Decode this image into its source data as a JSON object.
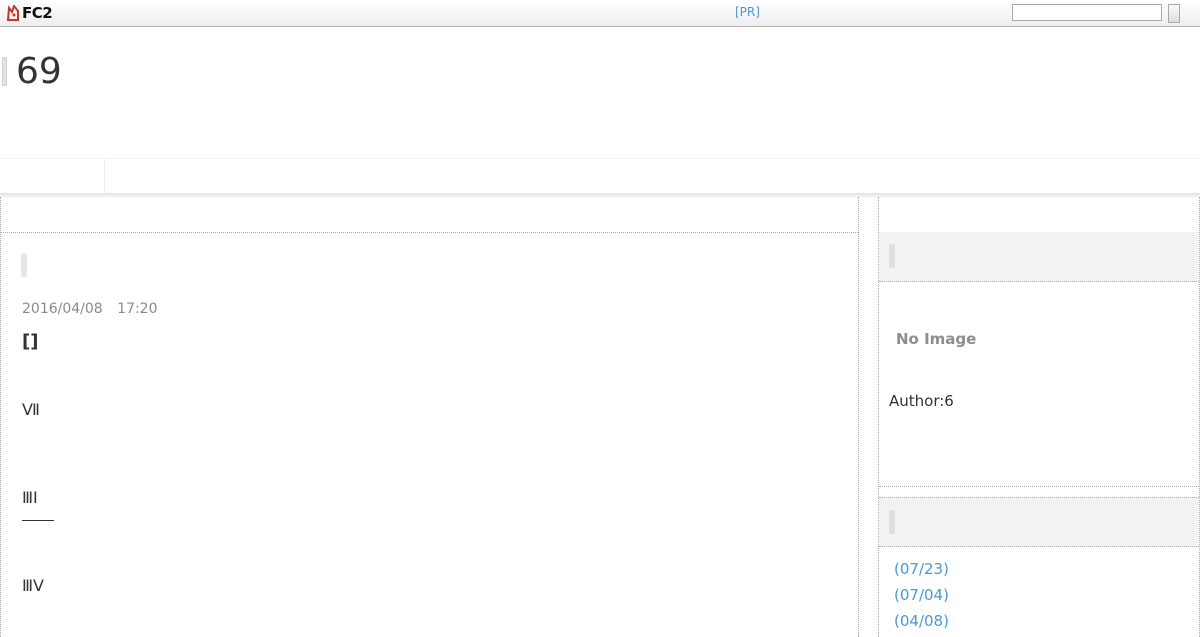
{
  "topbar": {
    "logo_text": "FC2",
    "pr_label": "[PR]",
    "search_value": ""
  },
  "header": {
    "title": "69"
  },
  "entry": {
    "date": "2016/04/08 17:20",
    "title": "[]",
    "lines": [
      "Ⅶ",
      "ⅢⅠ",
      "ⅢⅤ"
    ]
  },
  "sidebar": {
    "profile": {
      "no_image_label": "No Image",
      "author": "Author:6"
    },
    "archive": {
      "items": [
        "(07/23)",
        "(07/04)",
        "(04/08)"
      ]
    }
  },
  "colors": {
    "link": "#4a9ad0",
    "text": "#333333",
    "muted": "#8a8a8a",
    "panel": "#f2f2f2"
  }
}
